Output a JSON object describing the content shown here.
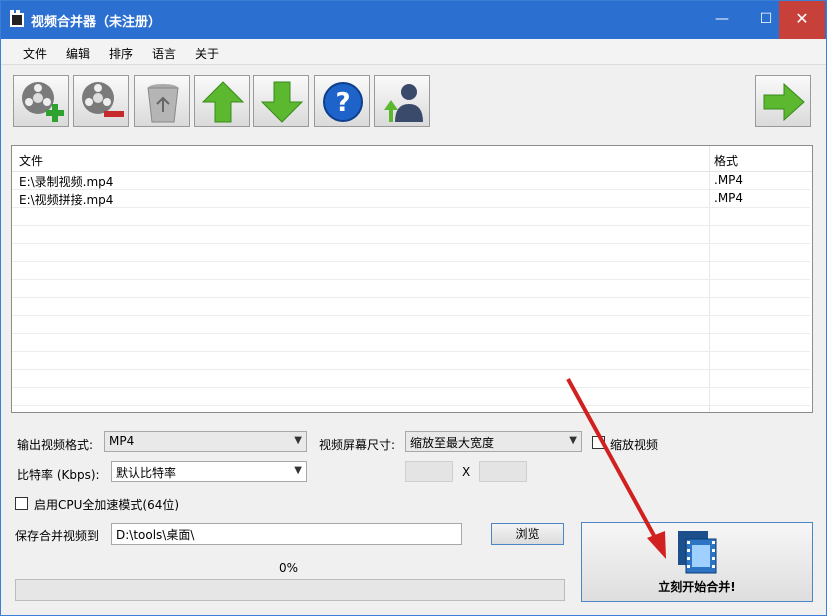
{
  "window": {
    "title": "视频合并器（未注册）",
    "min": "—",
    "max": "☐",
    "close": "✕"
  },
  "menu": [
    "文件",
    "编辑",
    "排序",
    "语言",
    "关于"
  ],
  "toolbar": {
    "buttons": [
      {
        "name": "add-video",
        "icon": "film-reel-add-icon"
      },
      {
        "name": "remove-video",
        "icon": "film-reel-remove-icon"
      },
      {
        "name": "clear-list",
        "icon": "recycle-bin-icon"
      },
      {
        "name": "move-up",
        "icon": "green-up-arrow-icon"
      },
      {
        "name": "move-down",
        "icon": "green-down-arrow-icon"
      },
      {
        "name": "help",
        "icon": "help-question-icon"
      },
      {
        "name": "upgrade",
        "icon": "user-upgrade-icon"
      },
      {
        "name": "next",
        "icon": "green-right-arrow-icon"
      }
    ]
  },
  "file_list": {
    "headers": {
      "file": "文件",
      "format": "格式"
    },
    "rows": [
      {
        "file": "E:\\录制视频.mp4",
        "format": ".MP4"
      },
      {
        "file": "E:\\视频拼接.mp4",
        "format": ".MP4"
      }
    ]
  },
  "settings": {
    "output_format_label": "输出视频格式:",
    "output_format_value": "MP4",
    "screen_size_label": "视频屏幕尺寸:",
    "screen_size_value": "缩放至最大宽度",
    "scale_video_label": "缩放视频",
    "bitrate_label": "比特率 (Kbps):",
    "bitrate_value": "默认比特率",
    "size_separator": "X",
    "cpu_accel_label": "启用CPU全加速模式(64位)",
    "save_to_label": "保存合并视频到",
    "save_path": "D:\\tools\\桌面\\",
    "browse_label": "浏览"
  },
  "progress": {
    "text": "0%",
    "value": 0
  },
  "merge_button": {
    "label": "立刻开始合并!"
  },
  "colors": {
    "titlebar": "#2b6fd1",
    "close": "#c7403a",
    "annotation_arrow": "#d21f1f"
  }
}
